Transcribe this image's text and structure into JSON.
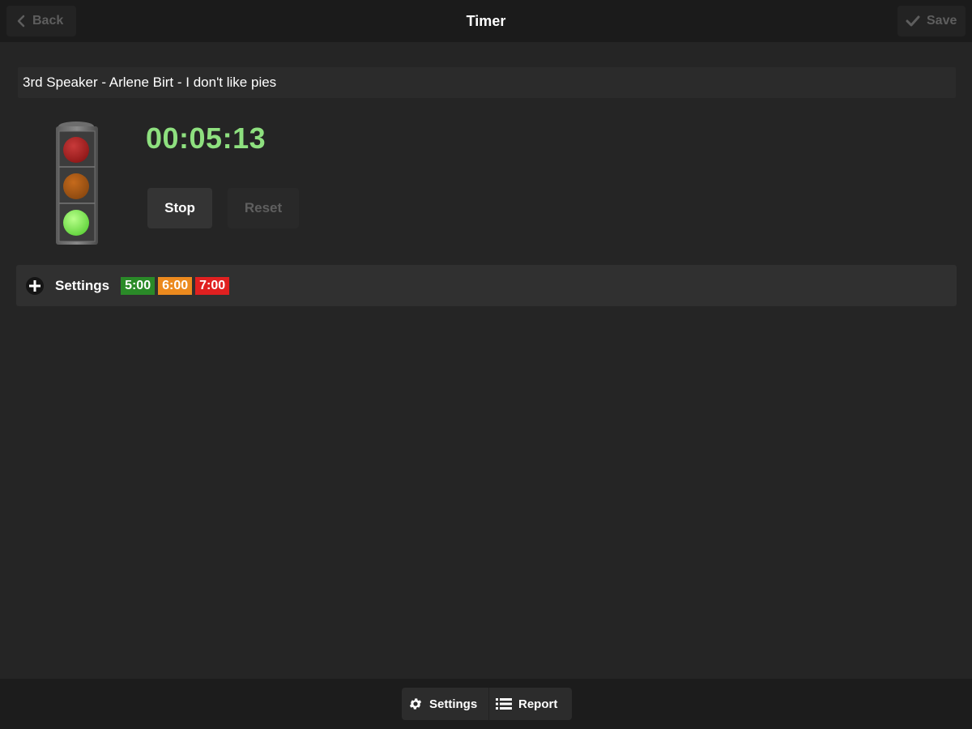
{
  "header": {
    "title": "Timer",
    "back_label": "Back",
    "save_label": "Save"
  },
  "speaker": {
    "value": "3rd Speaker - Arlene Birt - I don't like pies"
  },
  "timer": {
    "time": "00:05:13",
    "stop_label": "Stop",
    "reset_label": "Reset",
    "active_light": "green"
  },
  "settings": {
    "label": "Settings",
    "thresholds": [
      {
        "label": "5:00",
        "color": "#2a8a28"
      },
      {
        "label": "6:00",
        "color": "#ec8a1e"
      },
      {
        "label": "7:00",
        "color": "#e02020"
      }
    ]
  },
  "footer": {
    "settings_label": "Settings",
    "report_label": "Report"
  },
  "colors": {
    "timer_text": "#8ee07f",
    "background": "#252525",
    "header_bg": "#1b1b1b"
  },
  "icons": {
    "back": "chevron-left-icon",
    "save": "checkmark-icon",
    "settings_toggle": "plus-icon",
    "footer_settings": "gear-icon",
    "footer_report": "list-icon"
  }
}
